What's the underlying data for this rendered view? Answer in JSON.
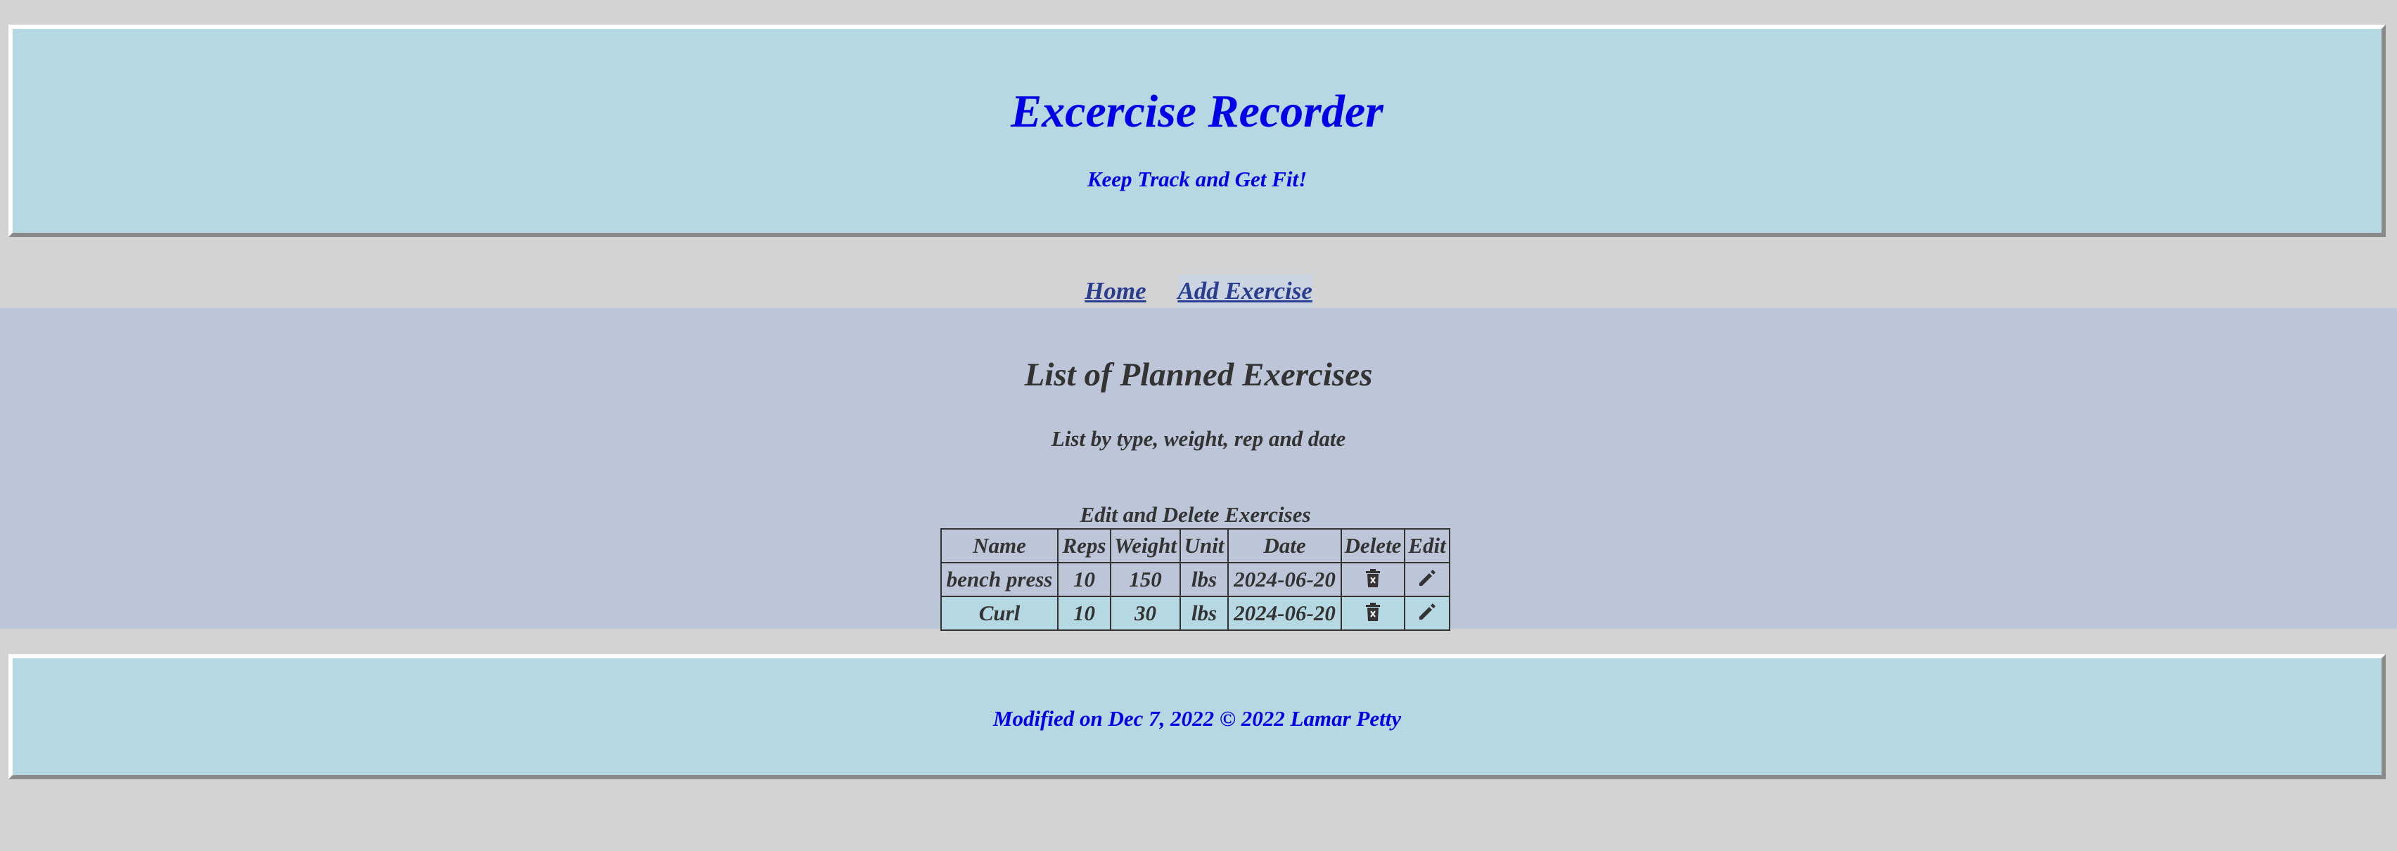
{
  "header": {
    "title": "Excercise Recorder",
    "tagline": "Keep Track and Get Fit!"
  },
  "nav": {
    "items": [
      {
        "label": "Home"
      },
      {
        "label": "Add Exercise"
      }
    ]
  },
  "main": {
    "title": "List of Planned Exercises",
    "subtitle": "List by type, weight, rep and date",
    "table": {
      "caption": "Edit and Delete Exercises",
      "columns": [
        "Name",
        "Reps",
        "Weight",
        "Unit",
        "Date",
        "Delete",
        "Edit"
      ],
      "rows": [
        {
          "name": "bench press",
          "reps": "10",
          "weight": "150",
          "unit": "lbs",
          "date": "2024-06-20",
          "delete_icon": "trash-icon",
          "edit_icon": "pencil-icon"
        },
        {
          "name": "Curl",
          "reps": "10",
          "weight": "30",
          "unit": "lbs",
          "date": "2024-06-20",
          "delete_icon": "trash-icon",
          "edit_icon": "pencil-icon"
        }
      ]
    }
  },
  "footer": {
    "text": "Modified on Dec 7, 2022 © 2022 Lamar Petty"
  },
  "colors": {
    "page_bg": "#d3d3d3",
    "banner_bg": "#b5d8e3",
    "main_bg": "#bcc6d8",
    "banner_text": "#0000e6",
    "main_text": "#333333",
    "nav_link": "#2a3d8f"
  }
}
